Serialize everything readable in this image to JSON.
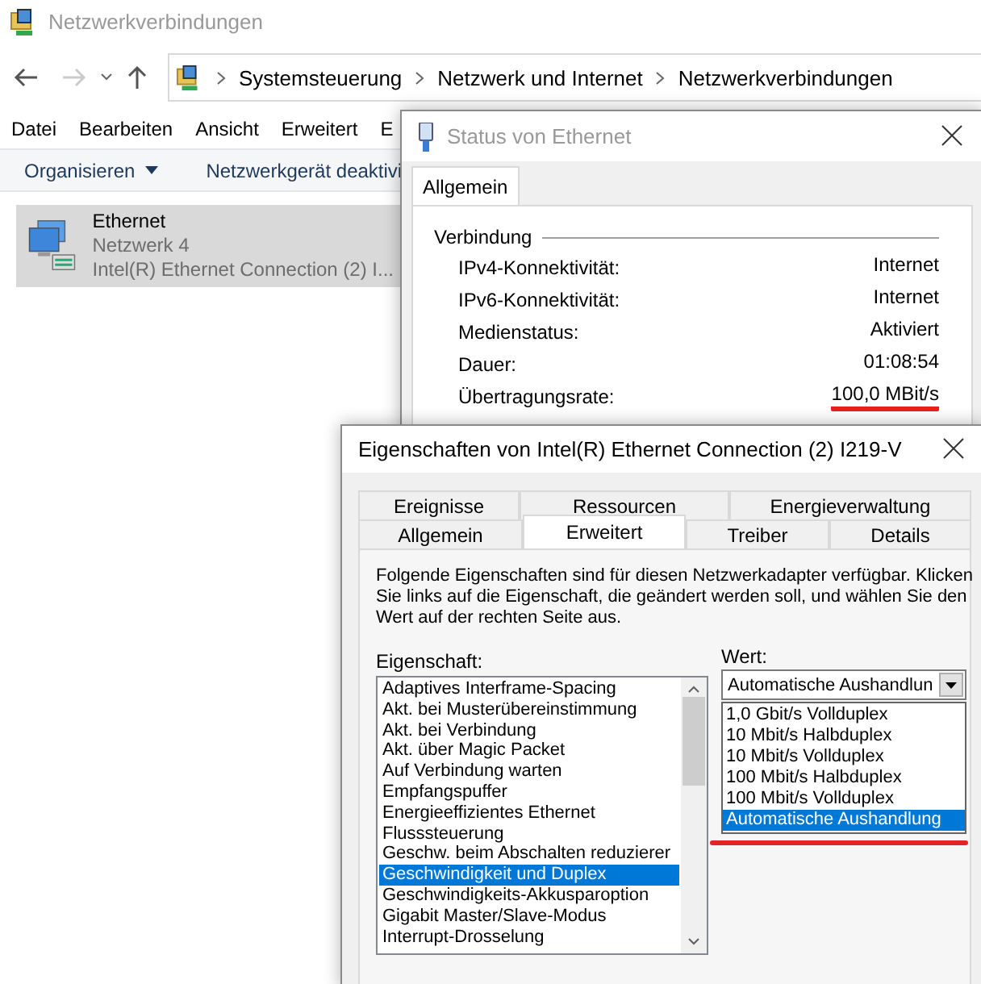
{
  "explorer": {
    "title": "Netzwerkverbindungen",
    "breadcrumb": [
      "Systemsteuerung",
      "Netzwerk und Internet",
      "Netzwerkverbindungen"
    ],
    "menu": [
      "Datei",
      "Bearbeiten",
      "Ansicht",
      "Erweitert",
      "E"
    ],
    "toolbar": [
      {
        "label": "Organisieren",
        "kind": "dropdown"
      },
      {
        "label": "Netzwerkgerät deaktivi",
        "kind": "button"
      }
    ],
    "item": {
      "name": "Ethernet",
      "network": "Netzwerk 4",
      "adapter": "Intel(R) Ethernet Connection (2) I...",
      "selected": true
    }
  },
  "status_dialog": {
    "title": "Status von Ethernet",
    "tabs": [
      {
        "label": "Allgemein",
        "selected": true
      }
    ],
    "group": "Verbindung",
    "rows": [
      {
        "label": "IPv4-Konnektivität:",
        "value": "Internet",
        "underlined": false
      },
      {
        "label": "IPv6-Konnektivität:",
        "value": "Internet",
        "underlined": false
      },
      {
        "label": "Medienstatus:",
        "value": "Aktiviert",
        "underlined": false
      },
      {
        "label": "Dauer:",
        "value": "01:08:54",
        "underlined": false
      },
      {
        "label": "Übertragungsrate:",
        "value": "100,0 MBit/s",
        "underlined": true
      }
    ]
  },
  "properties_dialog": {
    "title": "Eigenschaften von Intel(R) Ethernet Connection (2) I219-V",
    "tab_rows": [
      [
        {
          "label": "Ereignisse",
          "selected": false
        },
        {
          "label": "Ressourcen",
          "selected": false
        },
        {
          "label": "Energieverwaltung",
          "selected": false
        }
      ],
      [
        {
          "label": "Allgemein",
          "selected": false
        },
        {
          "label": "Erweitert",
          "selected": true
        },
        {
          "label": "Treiber",
          "selected": false
        },
        {
          "label": "Details",
          "selected": false
        }
      ]
    ],
    "description": "Folgende Eigenschaften sind für diesen Netzwerkadapter verfügbar. Klicken Sie links auf die Eigenschaft, die geändert werden soll, und wählen Sie den Wert auf der rechten Seite aus.",
    "property_label": "Eigenschaft:",
    "properties": [
      {
        "label": "Adaptives Interframe-Spacing",
        "selected": false
      },
      {
        "label": "Akt. bei Musterübereinstimmung",
        "selected": false
      },
      {
        "label": "Akt. bei Verbindung",
        "selected": false
      },
      {
        "label": "Akt. über Magic Packet",
        "selected": false
      },
      {
        "label": "Auf Verbindung warten",
        "selected": false
      },
      {
        "label": "Empfangspuffer",
        "selected": false
      },
      {
        "label": "Energieeffizientes Ethernet",
        "selected": false
      },
      {
        "label": "Flusssteuerung",
        "selected": false
      },
      {
        "label": "Geschw. beim Abschalten reduzierer",
        "selected": false
      },
      {
        "label": "Geschwindigkeit und Duplex",
        "selected": true
      },
      {
        "label": "Geschwindigkeits-Akkusparoption",
        "selected": false
      },
      {
        "label": "Gigabit Master/Slave-Modus",
        "selected": false
      },
      {
        "label": "Interrupt-Drosselung",
        "selected": false
      }
    ],
    "value_label": "Wert:",
    "value": "Automatische Aushandlun",
    "options_underlined": true,
    "options": [
      {
        "label": "1,0 Gbit/s Vollduplex",
        "selected": false
      },
      {
        "label": "10 Mbit/s Halbduplex",
        "selected": false
      },
      {
        "label": "10 Mbit/s Vollduplex",
        "selected": false
      },
      {
        "label": "100 Mbit/s Halbduplex",
        "selected": false
      },
      {
        "label": "100 Mbit/s Vollduplex",
        "selected": false
      },
      {
        "label": "Automatische Aushandlung",
        "selected": true
      }
    ]
  }
}
